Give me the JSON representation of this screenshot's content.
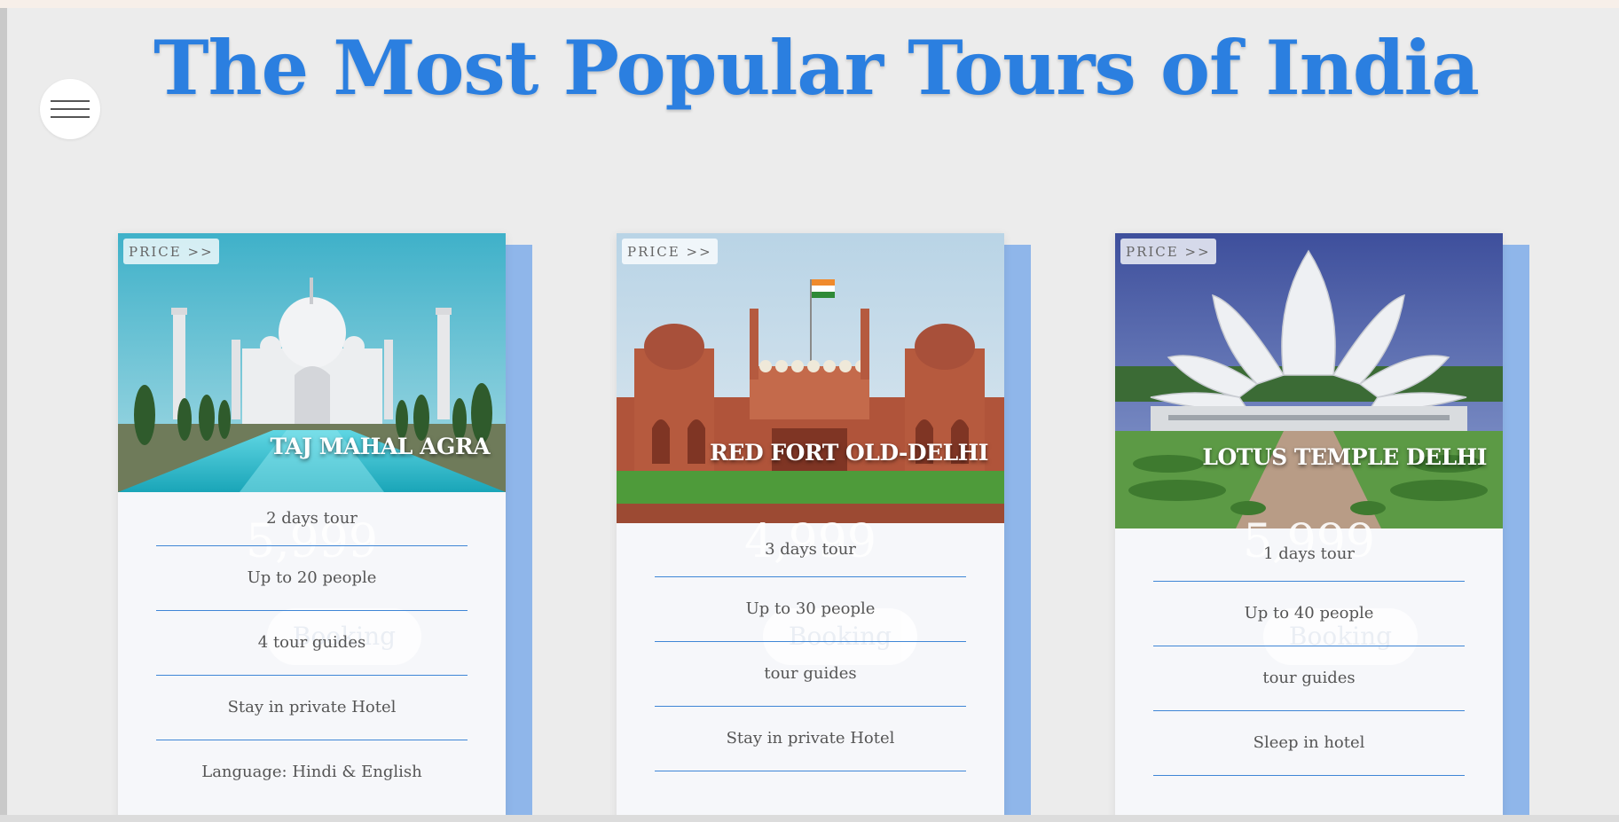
{
  "header": {
    "title": "The Most Popular Tours of India"
  },
  "menu": {
    "icon": "hamburger-icon"
  },
  "colors": {
    "title": "#2b7fe0",
    "accent": "#8fb6ea",
    "divider": "#3f86d6",
    "background": "#ececec"
  },
  "tours": [
    {
      "name": "TAJ MAHAL AGRA",
      "price_label": "PRICE >>",
      "price": "5,999",
      "booking_label": "Booking",
      "features": [
        "2 days tour",
        "Up to 20 people",
        "4 tour guides",
        "Stay in private Hotel",
        "Language: Hindi & English"
      ]
    },
    {
      "name": "RED FORT OLD-DELHI",
      "price_label": "PRICE >>",
      "price": "4,999",
      "booking_label": "Booking",
      "features": [
        "3 days tour",
        "Up to 30 people",
        "tour guides",
        "Stay in private Hotel"
      ]
    },
    {
      "name": "LOTUS TEMPLE DELHI",
      "price_label": "PRICE >>",
      "price": "5,999",
      "booking_label": "Booking",
      "features": [
        "1 days tour",
        "Up to 40 people",
        "tour guides",
        "Sleep in hotel"
      ]
    }
  ]
}
